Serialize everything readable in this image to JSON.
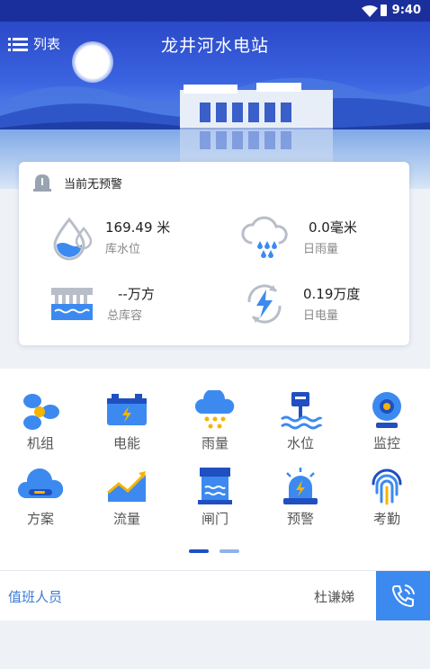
{
  "status_bar": {
    "time": "9:40"
  },
  "header": {
    "menu_label": "列表",
    "title": "龙井河水电站"
  },
  "warning": {
    "text": "当前无预警"
  },
  "stats": [
    {
      "value": "169.49 米",
      "label": "库水位",
      "icon": "water-drop-icon"
    },
    {
      "value": "0.0毫米",
      "label": "日雨量",
      "icon": "rain-cloud-icon"
    },
    {
      "value": "--万方",
      "label": "总库容",
      "icon": "reservoir-icon"
    },
    {
      "value": "0.19万度",
      "label": "日电量",
      "icon": "energy-cycle-icon"
    }
  ],
  "grid": [
    {
      "label": "机组",
      "icon": "turbine-icon"
    },
    {
      "label": "电能",
      "icon": "battery-icon"
    },
    {
      "label": "雨量",
      "icon": "rain-icon"
    },
    {
      "label": "水位",
      "icon": "water-level-icon"
    },
    {
      "label": "监控",
      "icon": "camera-icon"
    },
    {
      "label": "方案",
      "icon": "cloud-plan-icon"
    },
    {
      "label": "流量",
      "icon": "trend-chart-icon"
    },
    {
      "label": "闸门",
      "icon": "gate-icon"
    },
    {
      "label": "预警",
      "icon": "alarm-light-icon"
    },
    {
      "label": "考勤",
      "icon": "fingerprint-icon"
    }
  ],
  "pager": {
    "pages": 2,
    "current": 1
  },
  "duty": {
    "label": "值班人员",
    "name": "杜谦娣"
  },
  "colors": {
    "primary": "#3c8af0",
    "dark_blue": "#1b2f9c",
    "accent_yellow": "#f5b400"
  }
}
